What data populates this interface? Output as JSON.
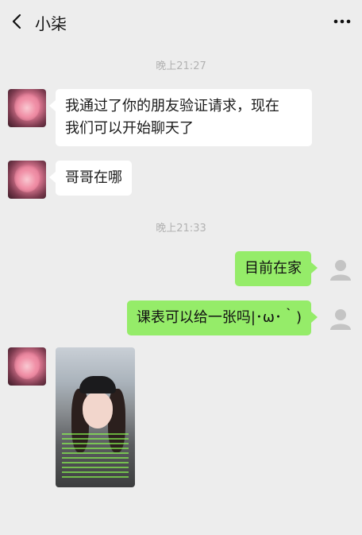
{
  "header": {
    "title": "小柒",
    "back_icon": "chevron-left-icon",
    "more_icon": "ellipsis-icon"
  },
  "timestamps": [
    "晚上21:27",
    "晚上21:33"
  ],
  "messages": [
    {
      "side": "in",
      "lines": [
        "我通过了你的朋友验证请求，现在",
        "我们可以开始聊天了"
      ]
    },
    {
      "side": "in",
      "text": "哥哥在哪"
    },
    {
      "side": "out",
      "text": "目前在家"
    },
    {
      "side": "out",
      "text": "课表可以给一张吗|･ω･｀)"
    },
    {
      "side": "in",
      "type": "image"
    }
  ],
  "colors": {
    "background": "#ededed",
    "bubble_in": "#ffffff",
    "bubble_out": "#95ec69",
    "timestamp": "#b2b2b2"
  }
}
